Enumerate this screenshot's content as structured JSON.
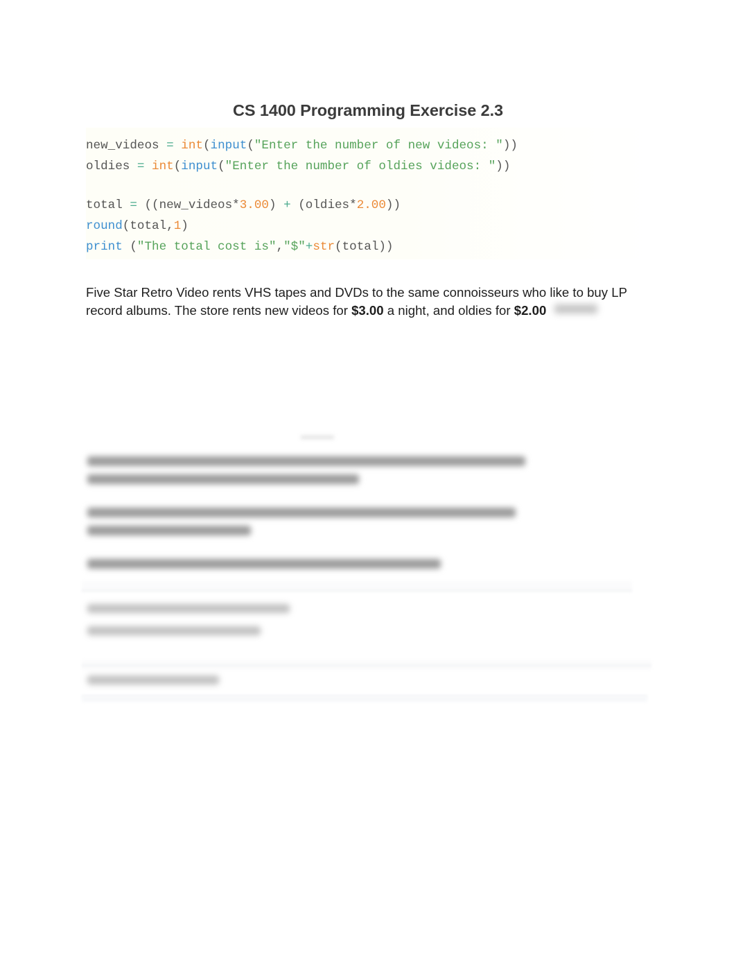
{
  "document": {
    "title": "CS 1400 Programming Exercise 2.3",
    "page_background": "#ffffff",
    "title_color": "#3b3b3b"
  },
  "code_block": {
    "language": "python",
    "background": "#fefef7",
    "text_color": "#555555",
    "syntax_colors": {
      "operator": "#4bab8e",
      "builtin_type": "#eb8a37",
      "function": "#3e8fd0",
      "string": "#56a35b",
      "number": "#eb8a37",
      "plain": "#555555"
    },
    "lines": [
      {
        "index": 0,
        "raw": "new_videos = int(input(\"Enter the number of new videos: \"))",
        "tokens": [
          {
            "text": "new_videos ",
            "type": "plain"
          },
          {
            "text": "=",
            "type": "operator"
          },
          {
            "text": " ",
            "type": "plain"
          },
          {
            "text": "int",
            "type": "builtin_type"
          },
          {
            "text": "(",
            "type": "plain"
          },
          {
            "text": "input",
            "type": "function"
          },
          {
            "text": "(",
            "type": "plain"
          },
          {
            "text": "\"Enter the number of new videos: \"",
            "type": "string"
          },
          {
            "text": "))",
            "type": "plain"
          }
        ]
      },
      {
        "index": 1,
        "raw": "oldies = int(input(\"Enter the number of oldies videos: \"))",
        "tokens": [
          {
            "text": "oldies ",
            "type": "plain"
          },
          {
            "text": "=",
            "type": "operator"
          },
          {
            "text": " ",
            "type": "plain"
          },
          {
            "text": "int",
            "type": "builtin_type"
          },
          {
            "text": "(",
            "type": "plain"
          },
          {
            "text": "input",
            "type": "function"
          },
          {
            "text": "(",
            "type": "plain"
          },
          {
            "text": "\"Enter the number of oldies videos: \"",
            "type": "string"
          },
          {
            "text": "))",
            "type": "plain"
          }
        ]
      },
      {
        "index": 2,
        "raw": "",
        "tokens": []
      },
      {
        "index": 3,
        "raw": "total = ((new_videos*3.00) + (oldies*2.00))",
        "tokens": [
          {
            "text": "total ",
            "type": "plain"
          },
          {
            "text": "=",
            "type": "operator"
          },
          {
            "text": " ((new_videos*",
            "type": "plain"
          },
          {
            "text": "3.00",
            "type": "number"
          },
          {
            "text": ") ",
            "type": "plain"
          },
          {
            "text": "+",
            "type": "operator"
          },
          {
            "text": " (oldies*",
            "type": "plain"
          },
          {
            "text": "2.00",
            "type": "number"
          },
          {
            "text": "))",
            "type": "plain"
          }
        ]
      },
      {
        "index": 4,
        "raw": "round(total,1)",
        "tokens": [
          {
            "text": "round",
            "type": "function"
          },
          {
            "text": "(total,",
            "type": "plain"
          },
          {
            "text": "1",
            "type": "number"
          },
          {
            "text": ")",
            "type": "plain"
          }
        ]
      },
      {
        "index": 5,
        "raw": "print (\"The total cost is\",\"$\"+str(total))",
        "tokens": [
          {
            "text": "print",
            "type": "function"
          },
          {
            "text": " (",
            "type": "plain"
          },
          {
            "text": "\"The total cost is\"",
            "type": "string"
          },
          {
            "text": ",",
            "type": "plain"
          },
          {
            "text": "\"$\"",
            "type": "string"
          },
          {
            "text": "+",
            "type": "operator"
          },
          {
            "text": "str",
            "type": "builtin_type"
          },
          {
            "text": "(total))",
            "type": "plain"
          }
        ]
      }
    ]
  },
  "body_paragraph": {
    "segment_1": "Five Star Retro Video rents VHS tapes and DVDs to the same connoisseurs who like to buy LP record albums. The store rents new videos for ",
    "price_new": "$3.00",
    "segment_2": " a night, and oldies for ",
    "price_oldies": "$2.00",
    "trailing_redacted": true
  },
  "redacted_content": {
    "note": "lower portion of the document is blurred / illegible",
    "blocks": [
      {
        "name": "paragraph-1",
        "lines": 2,
        "illegible": true
      },
      {
        "name": "paragraph-2",
        "lines": 2,
        "illegible": true
      },
      {
        "name": "paragraph-3",
        "lines": 1,
        "illegible": true
      },
      {
        "name": "io-sample-prompts",
        "lines": 2,
        "illegible": true
      },
      {
        "name": "io-sample-output",
        "lines": 1,
        "illegible": true
      }
    ]
  }
}
